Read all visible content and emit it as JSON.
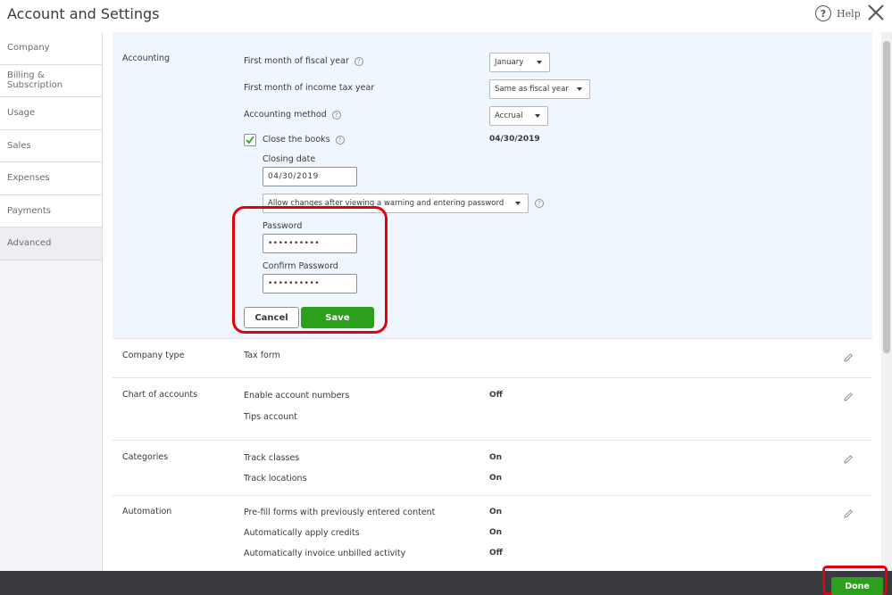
{
  "window": {
    "title": "Account and Settings",
    "help_label": "Help"
  },
  "sidebar": {
    "items": [
      {
        "label": "Company"
      },
      {
        "label": "Billing & Subscription"
      },
      {
        "label": "Usage"
      },
      {
        "label": "Sales"
      },
      {
        "label": "Expenses"
      },
      {
        "label": "Payments"
      },
      {
        "label": "Advanced"
      }
    ]
  },
  "accounting": {
    "heading": "Accounting",
    "fiscal_year_label": "First month of fiscal year",
    "fiscal_year_value": "January",
    "tax_year_label": "First month of income tax year",
    "tax_year_value": "Same as fiscal year",
    "method_label": "Accounting method",
    "method_value": "Accrual",
    "close_books_label": "Close the books",
    "close_books_checked": true,
    "close_books_date": "04/30/2019",
    "closing_date_label": "Closing date",
    "closing_date_value": "04/30/2019",
    "changes_option": "Allow changes after viewing a warning and entering password",
    "password_label": "Password",
    "password_value": "••••••••••",
    "confirm_password_label": "Confirm Password",
    "confirm_password_value": "••••••••••",
    "cancel_label": "Cancel",
    "save_label": "Save"
  },
  "company_type": {
    "heading": "Company type",
    "tax_form_label": "Tax form"
  },
  "chart_of_accounts": {
    "heading": "Chart of accounts",
    "enable_numbers_label": "Enable account numbers",
    "enable_numbers_value": "Off",
    "tips_account_label": "Tips account"
  },
  "categories": {
    "heading": "Categories",
    "track_classes_label": "Track classes",
    "track_classes_value": "On",
    "track_locations_label": "Track locations",
    "track_locations_value": "On"
  },
  "automation": {
    "heading": "Automation",
    "prefill_label": "Pre-fill forms with previously entered content",
    "prefill_value": "On",
    "apply_credits_label": "Automatically apply credits",
    "apply_credits_value": "On",
    "invoice_unbilled_label": "Automatically invoice unbilled activity",
    "invoice_unbilled_value": "Off"
  },
  "footer": {
    "done_label": "Done"
  },
  "colors": {
    "accent_green": "#2ca01c",
    "highlight_red": "#e3000f",
    "panel_blue": "#f0f6fd",
    "footer_dark": "#393a3d"
  }
}
